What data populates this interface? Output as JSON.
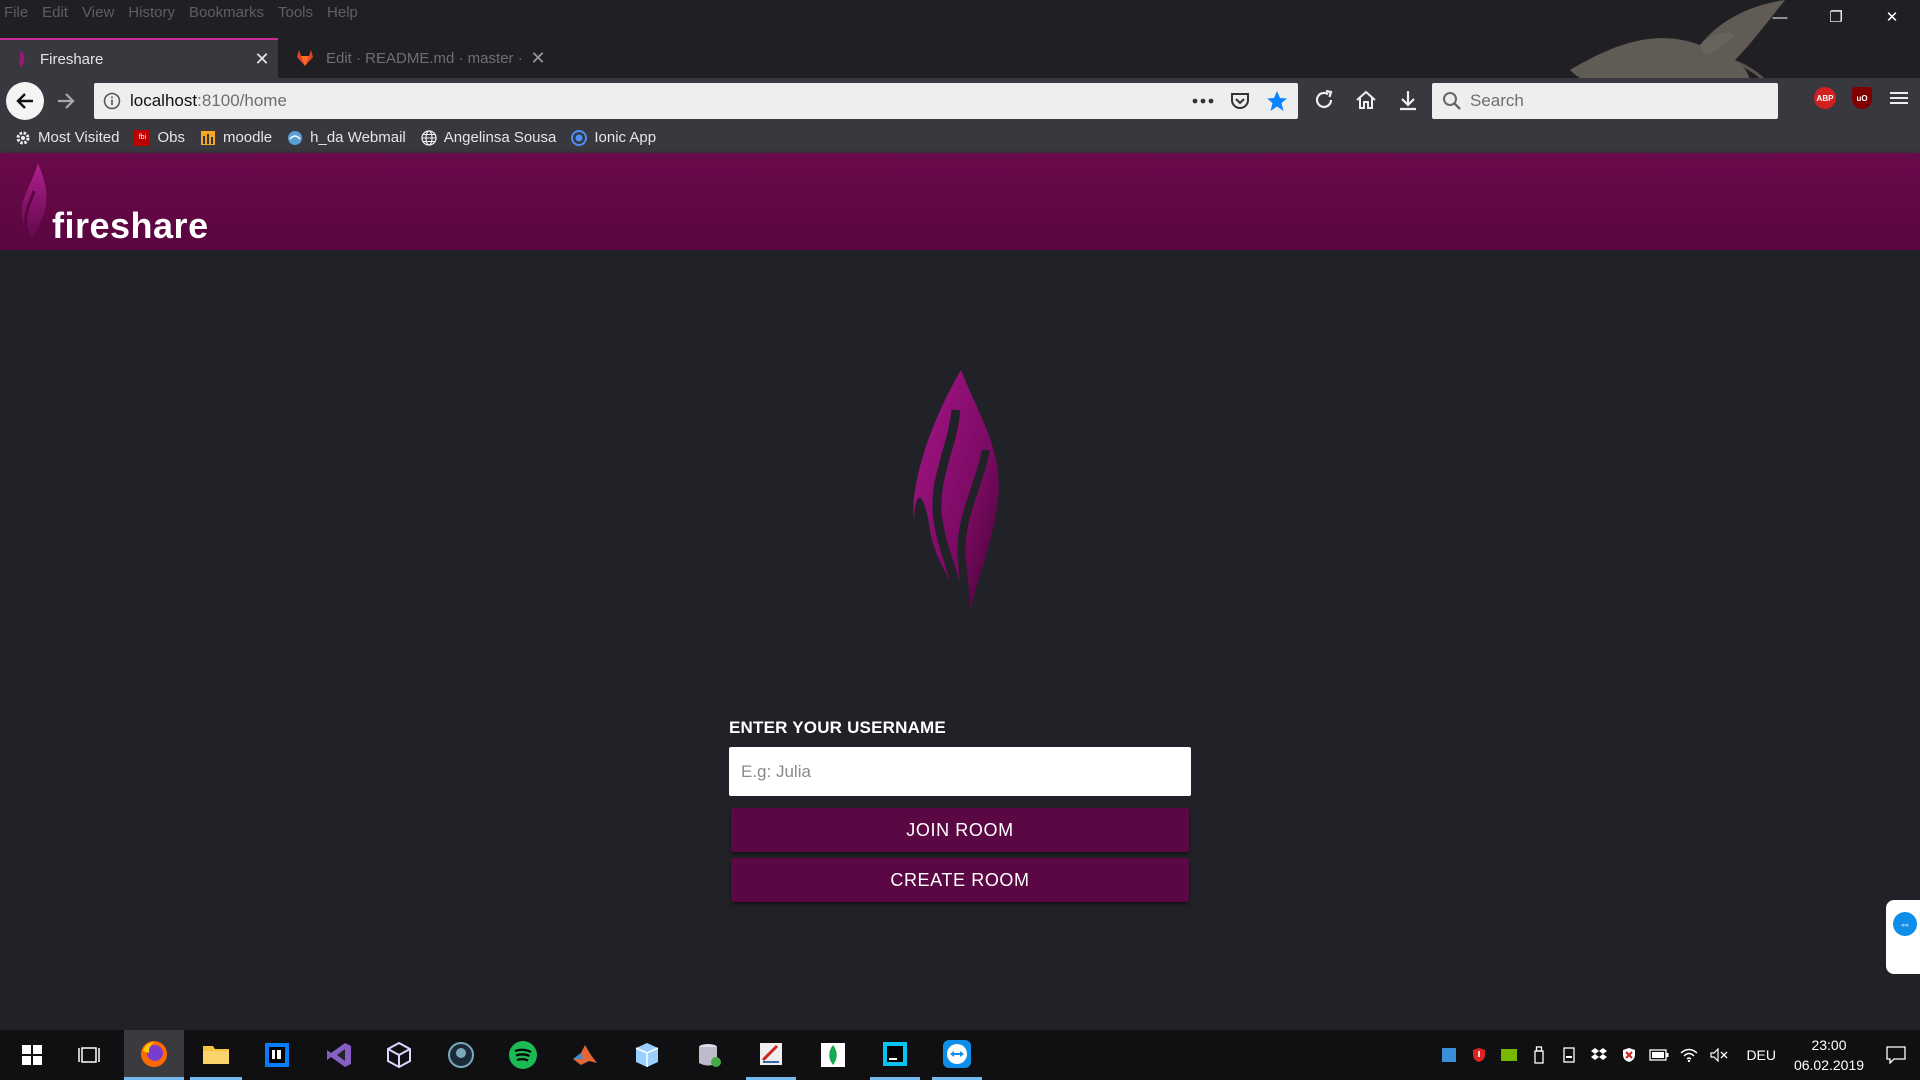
{
  "browser": {
    "menu": [
      "File",
      "Edit",
      "View",
      "History",
      "Bookmarks",
      "Tools",
      "Help"
    ],
    "window_controls": {
      "minimize": "—",
      "restore": "❐",
      "close": "✕"
    },
    "tabs": [
      {
        "title": "Fireshare",
        "close": "✕"
      },
      {
        "title": "Edit · README.md · master · Ko",
        "close": "✕"
      }
    ],
    "new_tab": "+",
    "url": {
      "host": "localhost",
      "path": ":8100/home"
    },
    "search_placeholder": "Search",
    "bookmarks": [
      {
        "label": "Most Visited",
        "icon": "gear-icon"
      },
      {
        "label": "Obs",
        "icon": "obs-icon"
      },
      {
        "label": "moodle",
        "icon": "moodle-icon"
      },
      {
        "label": "h_da Webmail",
        "icon": "webmail-icon"
      },
      {
        "label": "Angelinsa Sousa",
        "icon": "globe-icon"
      },
      {
        "label": "Ionic App",
        "icon": "ionic-icon"
      }
    ],
    "extensions": {
      "abp": "ABP",
      "ublock": "uO"
    }
  },
  "app": {
    "title": "fireshare",
    "brand_color": "#5a0743",
    "form": {
      "label": "ENTER YOUR USERNAME",
      "placeholder": "E.g: Julia",
      "value": "",
      "join_label": "JOIN ROOM",
      "create_label": "CREATE ROOM"
    }
  },
  "taskbar": {
    "apps": [
      "windows-start-icon",
      "task-view-icon",
      "firefox-icon",
      "file-explorer-icon",
      "intellij-icon",
      "visual-studio-icon",
      "virtualbox-icon",
      "gitkraken-icon",
      "spotify-icon",
      "matlab-icon",
      "box-icon",
      "database-icon",
      "editor-icon",
      "mongodb-icon",
      "webstorm-icon",
      "teamviewer-icon"
    ],
    "language": "DEU",
    "time": "23:00",
    "date": "06.02.2019"
  }
}
